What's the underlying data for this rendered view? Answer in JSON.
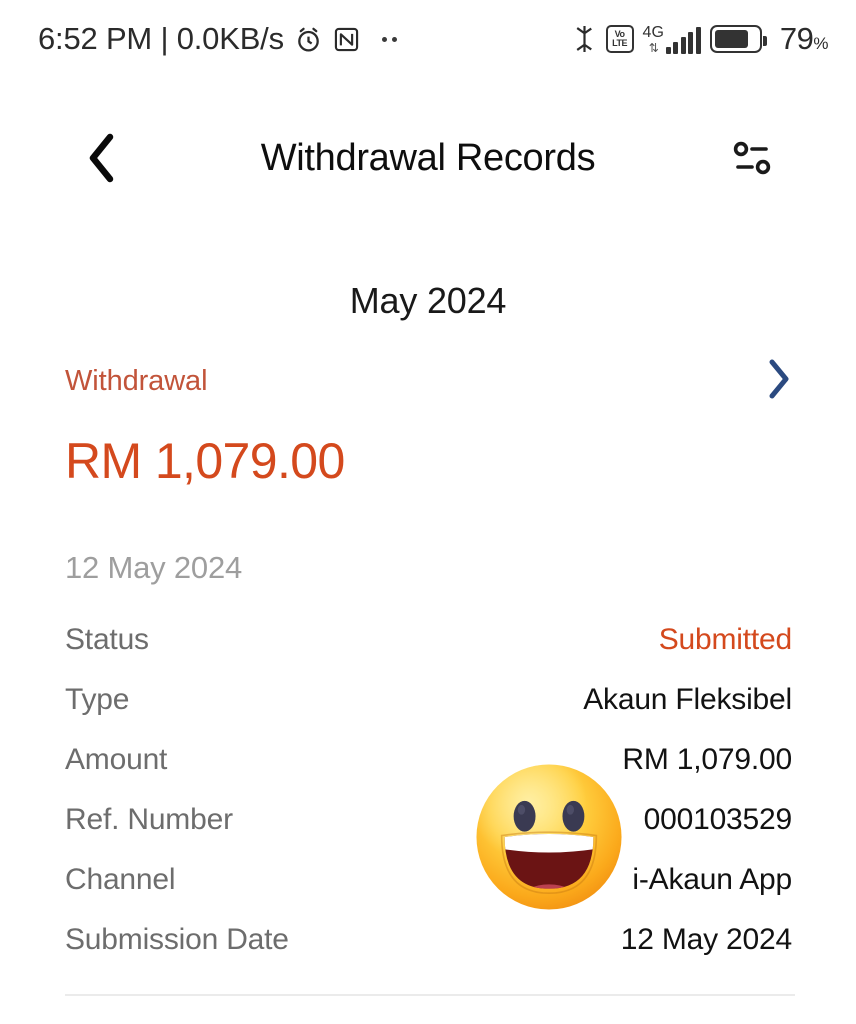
{
  "status_bar": {
    "clock_and_speed": "6:52 PM | 0.0KB/s",
    "alarm_icon": "alarm-clock-icon",
    "nfc_icon": "nfc-icon",
    "overflow_icon": "two-dots-icon",
    "bluetooth_icon": "bluetooth-icon",
    "volte_line1": "Vo",
    "volte_line2": "LTE",
    "network_type": "4G",
    "data_arrows": "⇅",
    "signal_bars": 5,
    "battery_percent": "79",
    "battery_percent_symbol": "%",
    "battery_level_pct": 79
  },
  "header": {
    "back_icon": "chevron-left-icon",
    "title": "Withdrawal Records",
    "filter_icon": "filter-settings-icon"
  },
  "month": {
    "label": "May 2024"
  },
  "summary": {
    "kind_label": "Withdrawal",
    "chevron_icon": "chevron-right-icon",
    "total_amount": "RM 1,079.00",
    "kind_color": "#c2543a",
    "amount_color": "#d4491d",
    "chevron_color": "#2b4a80"
  },
  "record": {
    "date": "12 May 2024",
    "details": [
      {
        "label": "Status",
        "value": "Submitted",
        "accent": true
      },
      {
        "label": "Type",
        "value": "Akaun Fleksibel",
        "accent": false
      },
      {
        "label": "Amount",
        "value": "RM 1,079.00",
        "accent": false
      },
      {
        "label": "Ref. Number",
        "value": "000103529",
        "accent": false
      },
      {
        "label": "Channel",
        "value": "i-Akaun App",
        "accent": false
      },
      {
        "label": "Submission Date",
        "value": "12 May 2024",
        "accent": false
      }
    ]
  },
  "overlay": {
    "emoji_icon": "grinning-face-emoji",
    "emoji_glyph": "😃"
  },
  "colors": {
    "accent_orange": "#d4491d",
    "muted_orange": "#c2543a",
    "label_gray": "#6d6d6d",
    "date_gray": "#9e9e9e",
    "divider": "#ebebeb",
    "text_black": "#121212"
  }
}
